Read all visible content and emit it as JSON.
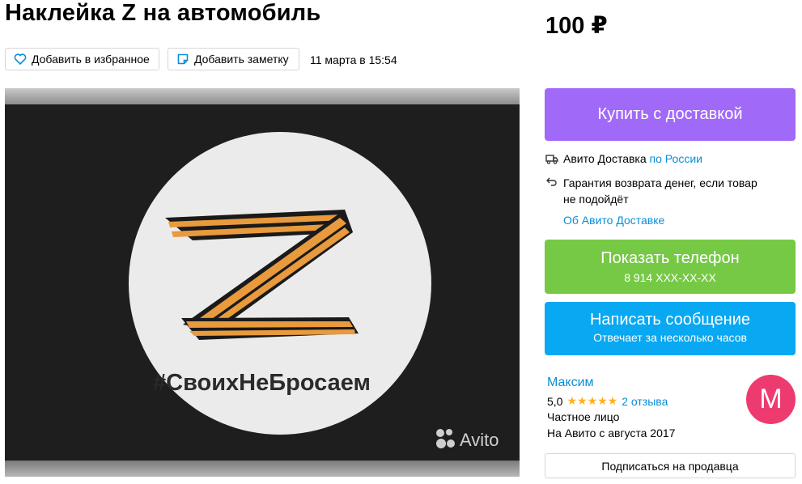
{
  "listing": {
    "title": "Наклейка Z на автомобиль",
    "price": "100 ₽",
    "date": "11 марта в 15:54"
  },
  "actions": {
    "favorite_label": "Добавить в избранное",
    "note_label": "Добавить заметку"
  },
  "photo": {
    "sticker_text": "#СвоихНеБросаем",
    "watermark": "Avito"
  },
  "delivery": {
    "buy_button": "Купить с доставкой",
    "service_label": "Авито Доставка",
    "service_scope": "по России",
    "guarantee_line1": "Гарантия возврата денег, если товар",
    "guarantee_line2": "не подойдёт",
    "about_link": "Об Авито Доставке"
  },
  "contact": {
    "phone_button": "Показать телефон",
    "phone_number": "8 914 XXX-XX-XX",
    "message_button": "Написать сообщение",
    "message_subtitle": "Отвечает за несколько часов"
  },
  "seller": {
    "name": "Максим",
    "rating": "5,0",
    "stars": "★★★★★",
    "reviews": "2 отзыва",
    "type": "Частное лицо",
    "since": "На Авито с августа 2017",
    "avatar_letter": "M",
    "subscribe_button": "Подписаться на продавца"
  },
  "colors": {
    "buy": "#a169f7",
    "phone": "#76c945",
    "message": "#08a8f2",
    "link": "#0a8ed6",
    "avatar": "#ed3b6f",
    "stars": "#ffb021"
  },
  "icons": [
    "heart-icon",
    "note-icon",
    "truck-icon",
    "return-arrow-icon",
    "avito-logo-icon"
  ]
}
